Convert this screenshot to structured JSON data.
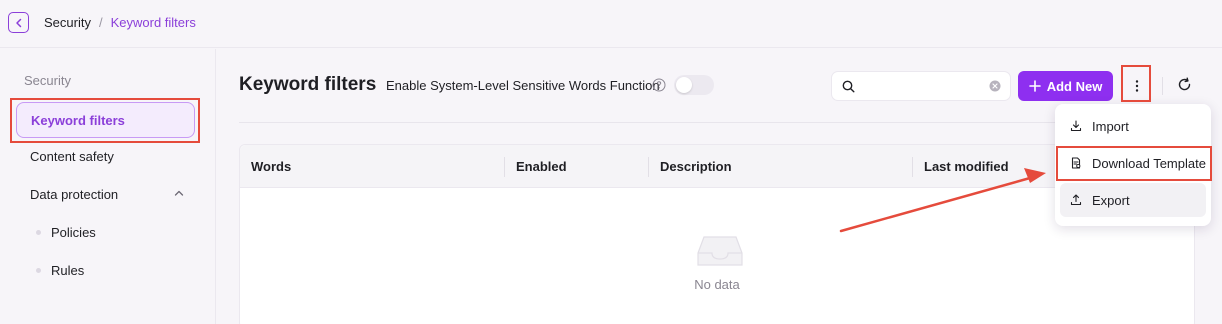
{
  "breadcrumb": {
    "root": "Security",
    "separator": "/",
    "current": "Keyword filters"
  },
  "sidebar": {
    "group_label": "Security",
    "items": [
      {
        "label": "Keyword filters"
      },
      {
        "label": "Content safety"
      },
      {
        "label": "Data protection"
      }
    ],
    "sub_items": [
      {
        "label": "Policies"
      },
      {
        "label": "Rules"
      }
    ]
  },
  "main": {
    "title": "Keyword filters",
    "toggle_label": "Enable System-Level Sensitive Words Function",
    "toggle_on": false,
    "search": {
      "value": "",
      "placeholder": ""
    },
    "add_button": "Add New"
  },
  "table": {
    "columns": [
      "Words",
      "Enabled",
      "Description",
      "Last modified"
    ],
    "rows": [],
    "empty_text": "No data"
  },
  "menu": {
    "items": [
      {
        "label": "Import",
        "icon": "import-icon"
      },
      {
        "label": "Download Template",
        "icon": "template-icon"
      },
      {
        "label": "Export",
        "icon": "export-icon"
      }
    ]
  },
  "colors": {
    "accent": "#8e2ff0",
    "accent_text": "#8b3fd9",
    "annotation": "#e54b3c"
  }
}
